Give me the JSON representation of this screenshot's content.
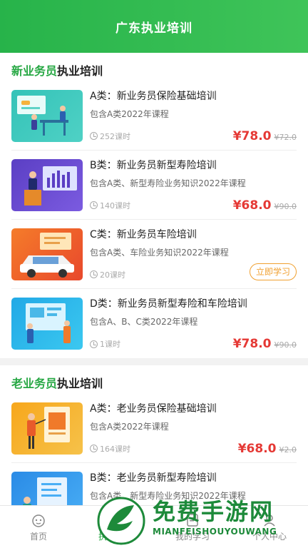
{
  "header": {
    "title": "广东执业培训"
  },
  "sections": [
    {
      "title_highlight": "新业务员",
      "title_rest": "执业培训",
      "courses": [
        {
          "title": "A类：新业务员保险基础培训",
          "desc": "包含A类2022年课程",
          "hours": "252课时",
          "price": "¥78.0",
          "old_price": "¥72.0",
          "action": ""
        },
        {
          "title": "B类：新业务员新型寿险培训",
          "desc": "包含A类、新型寿险业务知识2022年课程",
          "hours": "140课时",
          "price": "¥68.0",
          "old_price": "¥90.0",
          "action": ""
        },
        {
          "title": "C类：新业务员车险培训",
          "desc": "包含A类、车险业务知识2022年课程",
          "hours": "20课时",
          "price": "",
          "old_price": "",
          "action": "立即学习"
        },
        {
          "title": "D类：新业务员新型寿险和车险培训",
          "desc": "包含A、B、C类2022年课程",
          "hours": "1课时",
          "price": "¥78.0",
          "old_price": "¥90.0",
          "action": ""
        }
      ]
    },
    {
      "title_highlight": "老业务员",
      "title_rest": "执业培训",
      "courses": [
        {
          "title": "A类：老业务员保险基础培训",
          "desc": "包含A类2022年课程",
          "hours": "164课时",
          "price": "¥68.0",
          "old_price": "¥2.0",
          "action": ""
        },
        {
          "title": "B类：老业务员新型寿险培训",
          "desc": "包含A类、新型寿险业务知识2022年课程",
          "hours": "",
          "price": "",
          "old_price": "",
          "action": ""
        }
      ]
    }
  ],
  "tabbar": {
    "items": [
      {
        "label": "首页",
        "icon": "home-icon"
      },
      {
        "label": "执业培训",
        "icon": "training-icon"
      },
      {
        "label": "我的学习",
        "icon": "study-icon"
      },
      {
        "label": "个人中心",
        "icon": "user-icon"
      }
    ],
    "active_index": 1
  },
  "watermark": {
    "text": "免费手游网",
    "sub": "MIANFEISHOUYOUWANG"
  },
  "colors": {
    "brand_green": "#27b34a",
    "price_red": "#e53935",
    "button_orange": "#f0a030"
  }
}
